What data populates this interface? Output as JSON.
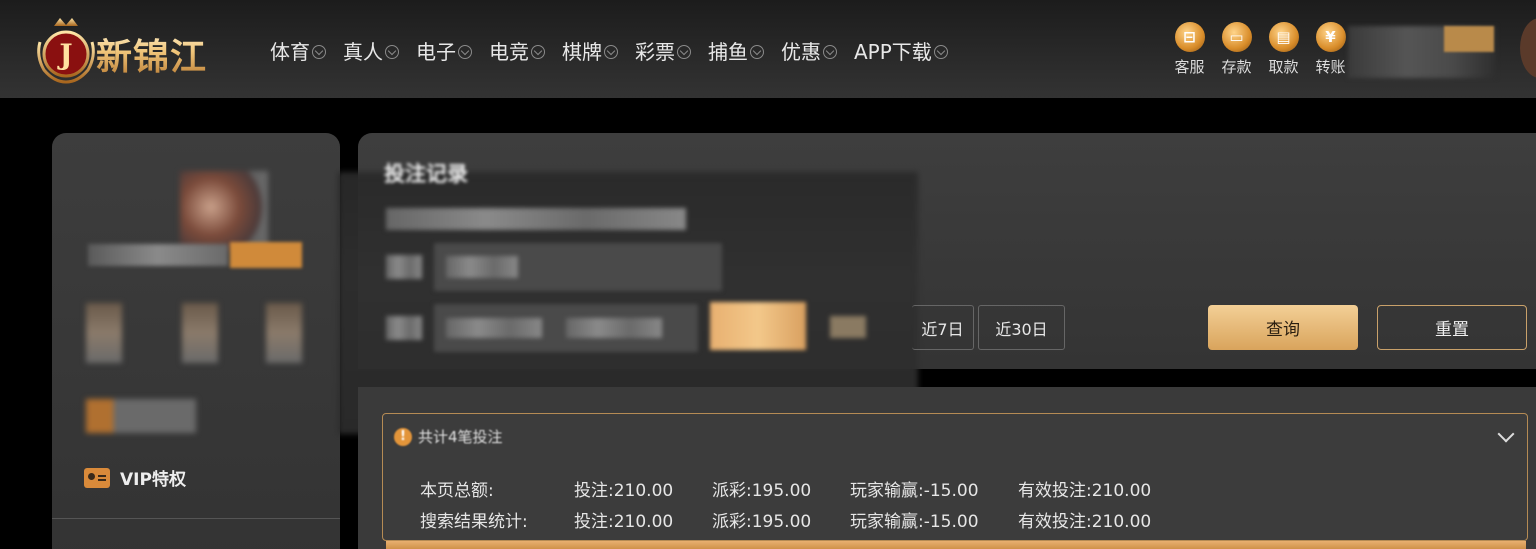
{
  "brand": {
    "name": "新锦江",
    "badge_letter": "J"
  },
  "nav": {
    "items": [
      {
        "label": "体育"
      },
      {
        "label": "真人"
      },
      {
        "label": "电子"
      },
      {
        "label": "电竞"
      },
      {
        "label": "棋牌"
      },
      {
        "label": "彩票"
      },
      {
        "label": "捕鱼"
      },
      {
        "label": "优惠"
      },
      {
        "label": "APP下载"
      }
    ]
  },
  "quick_actions": [
    {
      "label": "客服",
      "glyph": "⊟",
      "icon": "chat-icon"
    },
    {
      "label": "存款",
      "glyph": "▭",
      "icon": "wallet-icon"
    },
    {
      "label": "取款",
      "glyph": "▤",
      "icon": "cash-icon"
    },
    {
      "label": "转账",
      "glyph": "¥",
      "icon": "transfer-icon"
    }
  ],
  "sidebar": {
    "vip_label": "VIP特权"
  },
  "main": {
    "title": "投注记录",
    "range_buttons": [
      {
        "label": "近7日"
      },
      {
        "label": "近30日"
      }
    ],
    "query_label": "查询",
    "reset_label": "重置"
  },
  "summary": {
    "info_glyph": "!",
    "title": "共计4笔投注",
    "rows": [
      {
        "label": "本页总额:",
        "bet": "投注:210.00",
        "payout": "派彩:195.00",
        "player_win_loss": "玩家输赢:-15.00",
        "valid_bet": "有效投注:210.00"
      },
      {
        "label": "搜索结果统计:",
        "bet": "投注:210.00",
        "payout": "派彩:195.00",
        "player_win_loss": "玩家输赢:-15.00",
        "valid_bet": "有效投注:210.00"
      }
    ]
  },
  "colors": {
    "accent_gold": "#d9a45c",
    "panel_bg": "#3a3a3a",
    "page_bg": "#000000"
  }
}
